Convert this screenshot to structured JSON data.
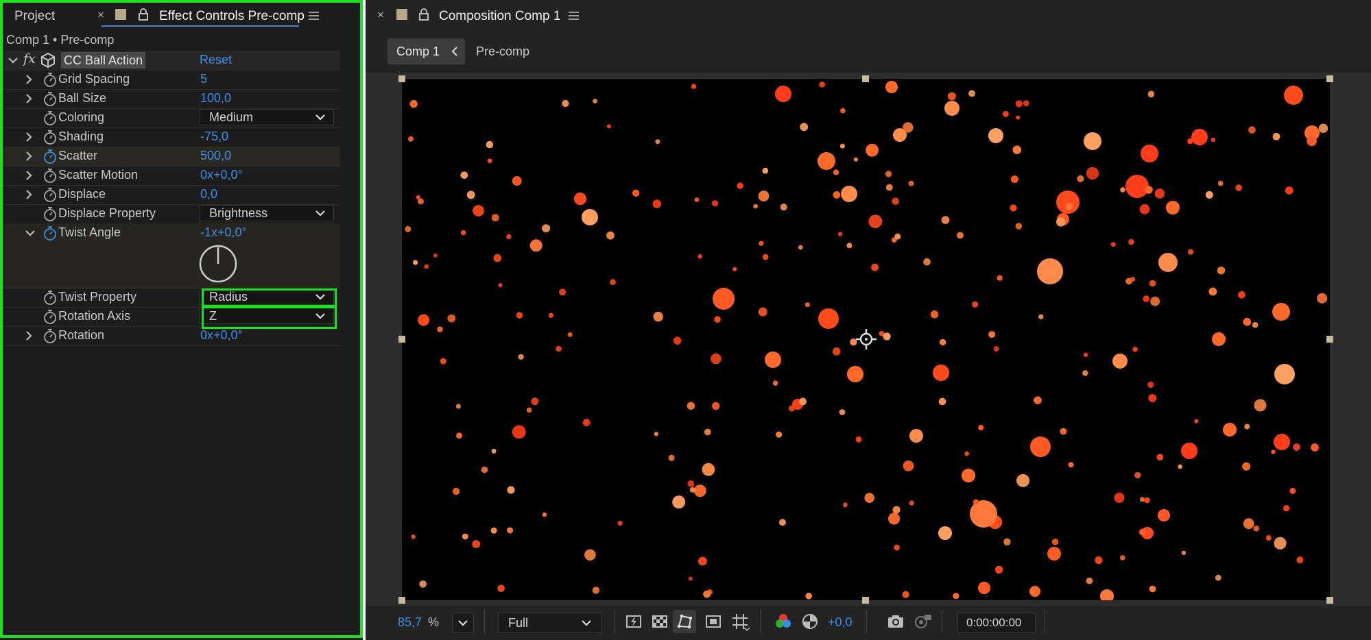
{
  "left_panel": {
    "tabs": {
      "project": "Project",
      "effect_controls": "Effect Controls Pre-comp"
    },
    "breadcrumb": "Comp 1 • Pre-comp",
    "effect": {
      "fx_label": "fx",
      "name": "CC Ball Action",
      "reset": "Reset"
    },
    "params": {
      "grid_spacing": {
        "label": "Grid Spacing",
        "value": "5"
      },
      "ball_size": {
        "label": "Ball Size",
        "value": "100,0"
      },
      "coloring": {
        "label": "Coloring",
        "value": "Medium"
      },
      "shading": {
        "label": "Shading",
        "value": "-75,0"
      },
      "scatter": {
        "label": "Scatter",
        "value": "500,0"
      },
      "scatter_motion": {
        "label": "Scatter Motion",
        "value": "0x+0,0°"
      },
      "displace": {
        "label": "Displace",
        "value": "0,0"
      },
      "displace_property": {
        "label": "Displace Property",
        "value": "Brightness"
      },
      "twist_angle": {
        "label": "Twist Angle",
        "value": "-1x+0,0°"
      },
      "twist_property": {
        "label": "Twist Property",
        "value": "Radius"
      },
      "rotation_axis": {
        "label": "Rotation Axis",
        "value": "Z"
      },
      "rotation": {
        "label": "Rotation",
        "value": "0x+0,0°"
      }
    }
  },
  "right_panel": {
    "tab_title": "Composition Comp 1",
    "breadcrumbs": [
      "Comp 1",
      "Pre-comp"
    ],
    "footer": {
      "zoom": "85,7",
      "zoom_unit": "%",
      "resolution": "Full",
      "exposure": "+0,0",
      "timecode": "0:00:00:00"
    }
  },
  "colors": {
    "accent_blue": "#3d8ee8",
    "highlight_green": "#1ee01e",
    "ball_orange": "#ff4a1c",
    "panel_bg": "#1d1d1d",
    "viewer_bg": "#232323"
  },
  "icons": [
    "close-icon",
    "lock-icon",
    "hamburger-menu-icon",
    "chevron-right-icon",
    "chevron-down-icon",
    "stopwatch-icon",
    "cube-icon",
    "fx-icon",
    "camera-snapshot-icon",
    "color-channels-icon",
    "exposure-reset-icon"
  ]
}
